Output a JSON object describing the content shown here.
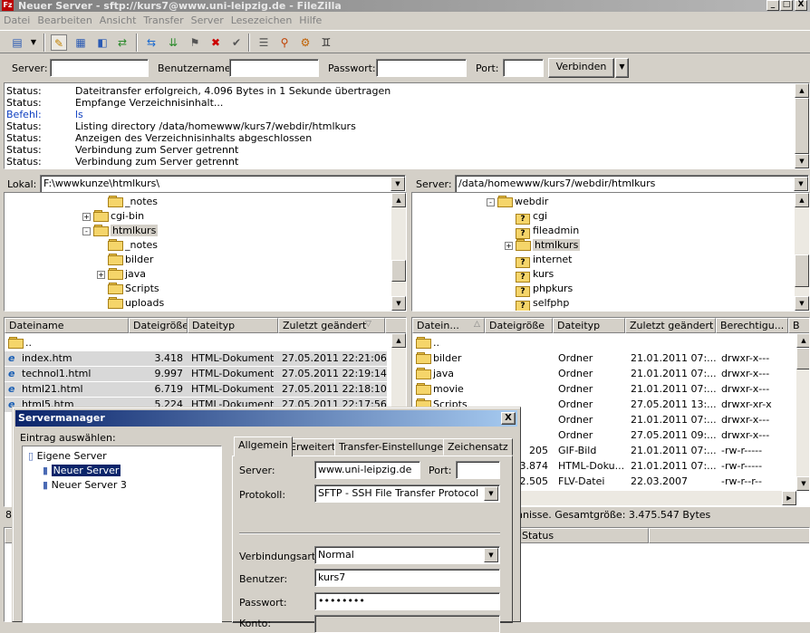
{
  "window": {
    "title": "Neuer Server - sftp://kurs7@www.uni-leipzig.de - FileZilla",
    "minimize": "_",
    "maximize": "□",
    "close": "X"
  },
  "menu": [
    "Datei",
    "Bearbeiten",
    "Ansicht",
    "Transfer",
    "Server",
    "Lesezeichen",
    "Hilfe"
  ],
  "quickconnect": {
    "server_label": "Server:",
    "user_label": "Benutzername:",
    "pass_label": "Passwort:",
    "port_label": "Port:",
    "connect_label": "Verbinden",
    "server_value": "",
    "user_value": "",
    "pass_value": "",
    "port_value": ""
  },
  "log": [
    {
      "type": "Status:",
      "msg": "Dateitransfer erfolgreich, 4.096 Bytes in 1 Sekunde übertragen"
    },
    {
      "type": "Status:",
      "msg": "Empfange Verzeichnisinhalt..."
    },
    {
      "type": "Befehl:",
      "msg": "ls"
    },
    {
      "type": "Status:",
      "msg": "Listing directory /data/homewww/kurs7/webdir/htmlkurs"
    },
    {
      "type": "Status:",
      "msg": "Anzeigen des Verzeichnisinhalts abgeschlossen"
    },
    {
      "type": "Status:",
      "msg": "Verbindung zum Server getrennt"
    },
    {
      "type": "Status:",
      "msg": "Verbindung zum Server getrennt"
    }
  ],
  "local": {
    "label": "Lokal:",
    "path": "F:\\wwwkunze\\htmlkurs\\",
    "tree": [
      {
        "name": "_notes",
        "exp": ""
      },
      {
        "name": "cgi-bin",
        "exp": "+"
      },
      {
        "name": "htmlkurs",
        "exp": "-"
      },
      {
        "name": "_notes",
        "exp": ""
      },
      {
        "name": "bilder",
        "exp": ""
      },
      {
        "name": "java",
        "exp": "+"
      },
      {
        "name": "Scripts",
        "exp": ""
      },
      {
        "name": "uploads",
        "exp": ""
      }
    ],
    "headers": [
      "Dateiname",
      "Dateigröße",
      "Dateityp",
      "Zuletzt geändert"
    ],
    "files": [
      {
        "name": "..",
        "size": "",
        "type": "",
        "date": ""
      },
      {
        "name": "index.htm",
        "size": "3.418",
        "type": "HTML-Dokument",
        "date": "27.05.2011 22:21:06"
      },
      {
        "name": "technol1.html",
        "size": "9.997",
        "type": "HTML-Dokument",
        "date": "27.05.2011 22:19:14"
      },
      {
        "name": "html21.html",
        "size": "6.719",
        "type": "HTML-Dokument",
        "date": "27.05.2011 22:18:10"
      },
      {
        "name": "html5.htm",
        "size": "5.224",
        "type": "HTML-Dokument",
        "date": "27.05.2011 22:17:56"
      }
    ],
    "status_count": "8"
  },
  "remote": {
    "label": "Server:",
    "path": "/data/homewww/kurs7/webdir/htmlkurs",
    "tree": [
      {
        "name": "webdir",
        "exp": "-",
        "q": false
      },
      {
        "name": "cgi",
        "exp": "",
        "q": true
      },
      {
        "name": "fileadmin",
        "exp": "",
        "q": true
      },
      {
        "name": "htmlkurs",
        "exp": "+",
        "q": false
      },
      {
        "name": "internet",
        "exp": "",
        "q": true
      },
      {
        "name": "kurs",
        "exp": "",
        "q": true
      },
      {
        "name": "phpkurs",
        "exp": "",
        "q": true
      },
      {
        "name": "selfphp",
        "exp": "",
        "q": true
      }
    ],
    "headers": [
      "Datein...",
      "Dateigröße",
      "Dateityp",
      "Zuletzt geändert",
      "Berechtigu...",
      "B"
    ],
    "files": [
      {
        "name": "..",
        "size": "",
        "type": "",
        "date": "",
        "perm": ""
      },
      {
        "name": "bilder",
        "size": "",
        "type": "Ordner",
        "date": "21.01.2011 07:...",
        "perm": "drwxr-x---"
      },
      {
        "name": "java",
        "size": "",
        "type": "Ordner",
        "date": "21.01.2011 07:...",
        "perm": "drwxr-x---"
      },
      {
        "name": "movie",
        "size": "",
        "type": "Ordner",
        "date": "21.01.2011 07:...",
        "perm": "drwxr-x---"
      },
      {
        "name": "Scripts",
        "size": "",
        "type": "Ordner",
        "date": "27.05.2011 13:...",
        "perm": "drwxr-xr-x"
      },
      {
        "name": "",
        "size": "",
        "type": "Ordner",
        "date": "21.01.2011 07:...",
        "perm": "drwxr-x---"
      },
      {
        "name": "",
        "size": "",
        "type": "Ordner",
        "date": "27.05.2011 09:...",
        "perm": "drwxr-x---"
      },
      {
        "name": "",
        "size": "205",
        "type": "GIF-Bild",
        "date": "21.01.2011 07:...",
        "perm": "-rw-r-----"
      },
      {
        "name": "",
        "size": "3.874",
        "type": "HTML-Doku...",
        "date": "21.01.2011 07:...",
        "perm": "-rw-r-----"
      },
      {
        "name": "",
        "size": "2.505",
        "type": "FLV-Datei",
        "date": "22.03.2007",
        "perm": "-rw-r--r--"
      }
    ],
    "status": "hnisse. Gesamtgröße: 3.475.547 Bytes"
  },
  "queue": {
    "status_header": "Status"
  },
  "servermanager": {
    "title": "Servermanager",
    "close": "X",
    "select_label": "Eintrag auswählen:",
    "tree": {
      "root": "Eigene Server",
      "items": [
        "Neuer Server",
        "Neuer Server 3"
      ]
    },
    "tabs": [
      "Allgemein",
      "Erweitert",
      "Transfer-Einstellungen",
      "Zeichensatz"
    ],
    "form": {
      "server_label": "Server:",
      "server_value": "www.uni-leipzig.de",
      "port_label": "Port:",
      "port_value": "",
      "protocol_label": "Protokoll:",
      "protocol_value": "SFTP - SSH File Transfer Protocol",
      "logon_label": "Verbindungsart:",
      "logon_value": "Normal",
      "user_label": "Benutzer:",
      "user_value": "kurs7",
      "pass_label": "Passwort:",
      "pass_value": "••••••••",
      "account_label": "Konto:"
    }
  }
}
